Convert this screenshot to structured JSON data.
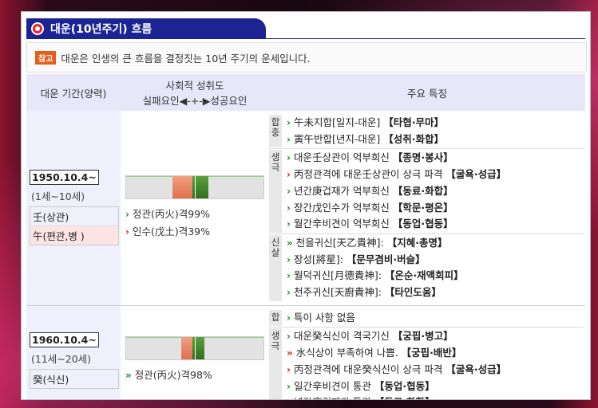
{
  "title": "대운(10년주기) 흐름",
  "note": {
    "badge": "참고",
    "text": "대운은 인생의 큰 흐름을 결정짓는 10년 주기의 운세입니다."
  },
  "header": {
    "period": "대운 기간(양력)",
    "score_title": "사회적 성취도",
    "score_scale": "실패요인◀-+-▶성공요인",
    "features": "주요 특징"
  },
  "rows": [
    {
      "date": "1950.10.4~",
      "age": "(1세~10세)",
      "stem": "壬(상관)",
      "branch": "午(편관,병 )",
      "bar_fill": {
        "orange": [
          0.34,
          0.48
        ],
        "green": [
          0.48,
          0.6
        ]
      },
      "levels": [
        {
          "arrow": "green",
          "text": "정관(丙火)격99%"
        },
        {
          "arrow": "red",
          "text": "인수(戊土)격39%"
        }
      ],
      "groups": [
        {
          "label": "합충",
          "items": [
            {
              "arrow": "green",
              "text": "午未지합[일지-대운]",
              "tag": "【타협·무마】"
            },
            {
              "arrow": "green",
              "text": "寅午반합[년지-대운]",
              "tag": "【성취·화합】"
            }
          ]
        },
        {
          "label": "생극",
          "items": [
            {
              "arrow": "green",
              "text": "대운壬상관이 억부희신",
              "tag": "【종명·봉사】"
            },
            {
              "arrow": "red",
              "text": "丙정관격에 대운壬상관이 상극 파격",
              "tag": "【굴욕·성급】"
            },
            {
              "arrow": "green",
              "text": "년간庚겁재가 억부희신",
              "tag": "【동료·화합】"
            },
            {
              "arrow": "green",
              "text": "장간戊인수가 억부희신",
              "tag": "【학문·평온】"
            },
            {
              "arrow": "green",
              "text": "월간辛비견이 억부희신",
              "tag": "【동업·협동】"
            }
          ]
        },
        {
          "label": "신살",
          "items": [
            {
              "arrow": "green2",
              "text": "천을귀신[天乙貴神]:",
              "tag": "【지혜·총명】"
            },
            {
              "arrow": "green",
              "text": "장성[將星]:",
              "tag": "【문무겸비·버슬】"
            },
            {
              "arrow": "green",
              "text": "월덕귀신[月德貴神]:",
              "tag": "【온순·재액회피】"
            },
            {
              "arrow": "green",
              "text": "천주귀신[天廚貴神]:",
              "tag": "【타인도움】"
            }
          ]
        }
      ]
    },
    {
      "date": "1960.10.4~",
      "age": "(11세~20세)",
      "stem": "癸(식신)",
      "branch": "",
      "bar_fill": {
        "orange": [
          0.4,
          0.48
        ],
        "green": [
          0.48,
          0.57
        ]
      },
      "levels": [
        {
          "arrow": "green2",
          "text": "정관(丙火)격98%"
        }
      ],
      "groups": [
        {
          "label": "합",
          "items": [
            {
              "arrow": "green",
              "text": "특이 사항 없음",
              "tag": ""
            }
          ]
        },
        {
          "label": "생극",
          "items": [
            {
              "arrow": "green",
              "text": "대운癸식신이 격국기신",
              "tag": "【궁핍·병고】"
            },
            {
              "arrow": "red2",
              "text": "水식상이 부족하여 나쁨.",
              "tag": "【궁핍·배반】"
            },
            {
              "arrow": "red",
              "text": "丙정관격에 대운癸식신이 상극 파격",
              "tag": "【굴욕·성급】"
            },
            {
              "arrow": "green",
              "text": "일간辛비견이 통관",
              "tag": "【동업·협동】"
            },
            {
              "arrow": "green",
              "text": "년간庚겁재가 통관",
              "tag": "【동료·화합】"
            }
          ]
        }
      ]
    }
  ]
}
